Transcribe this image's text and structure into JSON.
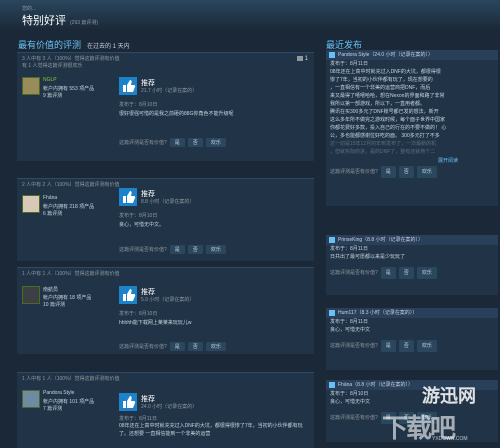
{
  "header": {
    "crumb": "您的... ",
    "title": "特别好评",
    "count": "(293 篇评测)"
  },
  "left": {
    "heading": "最有价值的评测",
    "subheading": "在过去的 1 天内"
  },
  "right": {
    "heading": "最近发布"
  },
  "buttons": {
    "yes": "是",
    "no": "否",
    "funny": "欢乐",
    "helpful_q": "这篇评测是否有价值?"
  },
  "reviews": [
    {
      "helpful_line": "3 人中有 3 人（100%）觉得这篇评测有价值",
      "funny_line": "有 1 人觉得这篇评测很欢乐",
      "comments": "1",
      "name": "NGLP",
      "products": "帐户内拥有 553 项产品",
      "reviews": "9 篇评测",
      "verdict": "推荐",
      "hours": "21.7 小时（记录在案的）",
      "posted": "发布于：8月10日",
      "content": "很好很强可惜的是我之前砸的88G你角色不能升级呢"
    },
    {
      "helpful_line": "2 人中有 2 人（100%）觉得这篇评测有价值",
      "name": "Fhāna",
      "products": "帐户内拥有 218 项产品",
      "reviews": "6 篇评测",
      "verdict": "推荐",
      "hours": "8.8 小时（记录在案的）",
      "posted": "发布于：8月10日",
      "content": "良心，可惜无中文。"
    },
    {
      "helpful_line": "1 人中有 1 人（100%）觉得这篇评测有价值",
      "name": "南航员",
      "products": "帐户内拥有 18 项产品",
      "reviews": "10 篇评测",
      "verdict": "推荐",
      "hours": "5.9 小时（记录在案的）",
      "posted": "发布于：8月10日",
      "content": "hhhhh能下载网上莱莱来玩玩儿w"
    },
    {
      "helpful_line": "1 人中有 1 人（100%）觉得这篇评测有价值",
      "name": "Pandora Style",
      "products": "帐户内拥有 101 项产品",
      "reviews": "7 篇评测",
      "verdict": "推荐",
      "hours": "24.0 小时（记录在案的）",
      "posted": "发布于：8月11日",
      "content": "08年还在上高中时就充充过入DNF的大坑，都很得很惨了7年，当初的小伙伴都有玩了。还想要 一直相信能到一个非美的运营"
    }
  ],
  "recent": [
    {
      "head": "Pandora Style（24.0 小时（记录在案的））",
      "posted": "发布于：8月11日",
      "lines": [
        "08年还在上高中时就充过入DNF的大坑，都很得很",
        "惨了7年，当初的小伙伴都有玩了，现在想要的",
        "，一直相信有一个非美的运营商把DNF，而后",
        "来又最得了嘻嘻哈哈，想在Nexon的界面和路了非常",
        "我所以第一部游戏，所以下，一直用者都。",
        "",
        "腾讯在买300多元了DNF账号都已发的想法，新开",
        "这么多年所不做完之游戏时候，每个面子世界中国家",
        "你都花费好多款，投入自己的行在的不要不做的！ 心",
        "公，多也能都感谢位好吃的面。 300多元打了不多",
        "",
        "达一切是15年12月的年到发布了，一次最新的机",
        "，但就实际的进，是的DNF了，整有还就地个二"
      ],
      "funny": "欢乐",
      "more": "展开阅读"
    },
    {
      "head": "PrinseKing（8.8 小时（记录在案的））",
      "posted": "发布于：8月11日",
      "lines": [
        "日共出了最可愿都以来是少玩玩了"
      ],
      "funny": "欢乐"
    },
    {
      "head": "Hum117（8.3 小时（记录在案的））",
      "posted": "发布于：8月11日",
      "lines": [
        "良心，可惜无中文"
      ],
      "funny": "欢乐"
    },
    {
      "head": "Fhāna（8.8 小时（记录在案的））",
      "posted": "发布于：8月10日",
      "lines": [
        "良心，可惜无中文"
      ],
      "funny": "欢乐"
    }
  ],
  "watermark": {
    "top": "游迅网",
    "big": "下载吧",
    "url": "YXDOWN.COM"
  },
  "colors": {
    "background": "#1b2838",
    "accent": "#67c1f5",
    "thumb": "#1c82c9",
    "name_green": "#8bc53f"
  }
}
